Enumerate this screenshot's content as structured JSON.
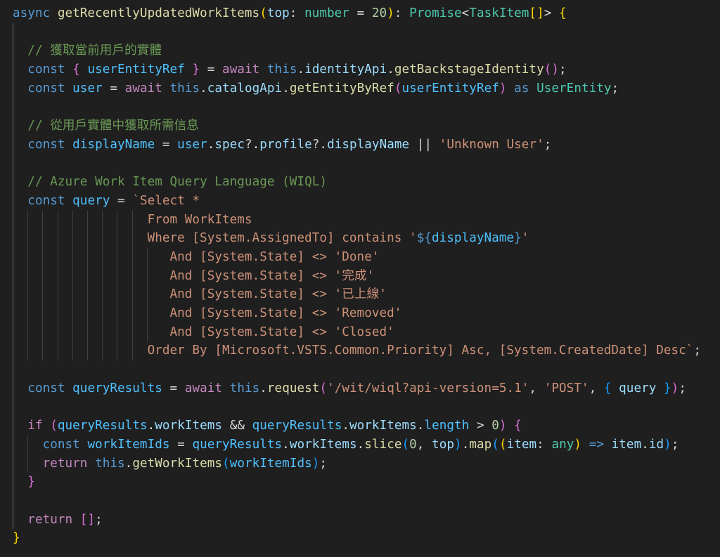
{
  "editor": {
    "theme_colors": {
      "background": "#1f1f1f",
      "keyword": "#569cd6",
      "control": "#c586c0",
      "function": "#dcdcaa",
      "variable": "#9cdcfe",
      "type": "#4ec9b0",
      "string": "#ce9178",
      "number": "#b5cea8",
      "comment": "#6a9955",
      "bracket_1": "#ffd700",
      "bracket_2": "#da70d6",
      "bracket_3": "#179fff"
    },
    "lines": [
      {
        "tokens": [
          {
            "t": "async ",
            "c": "kw"
          },
          {
            "t": "getRecentlyUpdatedWorkItems",
            "c": "fn"
          },
          {
            "t": "(",
            "c": "b1"
          },
          {
            "t": "top",
            "c": "var"
          },
          {
            "t": ": ",
            "c": "punc"
          },
          {
            "t": "number",
            "c": "type"
          },
          {
            "t": " = ",
            "c": "punc"
          },
          {
            "t": "20",
            "c": "num"
          },
          {
            "t": ")",
            "c": "b1"
          },
          {
            "t": ": ",
            "c": "punc"
          },
          {
            "t": "Promise",
            "c": "type"
          },
          {
            "t": "<",
            "c": "punc"
          },
          {
            "t": "TaskItem",
            "c": "type"
          },
          {
            "t": "[]",
            "c": "b1"
          },
          {
            "t": "> ",
            "c": "punc"
          },
          {
            "t": "{",
            "c": "b1"
          }
        ]
      },
      {
        "tokens": []
      },
      {
        "tokens": [
          {
            "t": "  ",
            "c": "punc"
          },
          {
            "t": "// 獲取當前用戶的實體",
            "c": "com"
          }
        ]
      },
      {
        "tokens": [
          {
            "t": "  ",
            "c": "punc"
          },
          {
            "t": "const ",
            "c": "kw"
          },
          {
            "t": "{ ",
            "c": "b2"
          },
          {
            "t": "userEntityRef",
            "c": "const"
          },
          {
            "t": " }",
            "c": "b2"
          },
          {
            "t": " = ",
            "c": "punc"
          },
          {
            "t": "await ",
            "c": "ctrl"
          },
          {
            "t": "this",
            "c": "kw"
          },
          {
            "t": ".",
            "c": "punc"
          },
          {
            "t": "identityApi",
            "c": "var"
          },
          {
            "t": ".",
            "c": "punc"
          },
          {
            "t": "getBackstageIdentity",
            "c": "fn"
          },
          {
            "t": "()",
            "c": "b2"
          },
          {
            "t": ";",
            "c": "punc"
          }
        ]
      },
      {
        "tokens": [
          {
            "t": "  ",
            "c": "punc"
          },
          {
            "t": "const ",
            "c": "kw"
          },
          {
            "t": "user",
            "c": "const"
          },
          {
            "t": " = ",
            "c": "punc"
          },
          {
            "t": "await ",
            "c": "ctrl"
          },
          {
            "t": "this",
            "c": "kw"
          },
          {
            "t": ".",
            "c": "punc"
          },
          {
            "t": "catalogApi",
            "c": "var"
          },
          {
            "t": ".",
            "c": "punc"
          },
          {
            "t": "getEntityByRef",
            "c": "fn"
          },
          {
            "t": "(",
            "c": "b2"
          },
          {
            "t": "userEntityRef",
            "c": "const"
          },
          {
            "t": ")",
            "c": "b2"
          },
          {
            "t": " as ",
            "c": "kw"
          },
          {
            "t": "UserEntity",
            "c": "type"
          },
          {
            "t": ";",
            "c": "punc"
          }
        ]
      },
      {
        "tokens": []
      },
      {
        "tokens": [
          {
            "t": "  ",
            "c": "punc"
          },
          {
            "t": "// 從用戶實體中獲取所需信息",
            "c": "com"
          }
        ]
      },
      {
        "tokens": [
          {
            "t": "  ",
            "c": "punc"
          },
          {
            "t": "const ",
            "c": "kw"
          },
          {
            "t": "displayName",
            "c": "const"
          },
          {
            "t": " = ",
            "c": "punc"
          },
          {
            "t": "user",
            "c": "const"
          },
          {
            "t": ".",
            "c": "punc"
          },
          {
            "t": "spec",
            "c": "var"
          },
          {
            "t": "?.",
            "c": "punc"
          },
          {
            "t": "profile",
            "c": "var"
          },
          {
            "t": "?.",
            "c": "punc"
          },
          {
            "t": "displayName",
            "c": "var"
          },
          {
            "t": " || ",
            "c": "punc"
          },
          {
            "t": "'Unknown User'",
            "c": "str"
          },
          {
            "t": ";",
            "c": "punc"
          }
        ]
      },
      {
        "tokens": []
      },
      {
        "tokens": [
          {
            "t": "  ",
            "c": "punc"
          },
          {
            "t": "// Azure Work Item Query Language (WIQL)",
            "c": "com"
          }
        ]
      },
      {
        "tokens": [
          {
            "t": "  ",
            "c": "punc"
          },
          {
            "t": "const ",
            "c": "kw"
          },
          {
            "t": "query",
            "c": "const"
          },
          {
            "t": " = ",
            "c": "punc"
          },
          {
            "t": "`Select *",
            "c": "str"
          }
        ]
      },
      {
        "tokens": [
          {
            "t": "                  ",
            "c": "punc"
          },
          {
            "t": "From WorkItems",
            "c": "str"
          }
        ]
      },
      {
        "tokens": [
          {
            "t": "                  ",
            "c": "punc"
          },
          {
            "t": "Where [System.AssignedTo] contains '",
            "c": "str"
          },
          {
            "t": "${",
            "c": "kw"
          },
          {
            "t": "displayName",
            "c": "const"
          },
          {
            "t": "}",
            "c": "kw"
          },
          {
            "t": "'",
            "c": "str"
          }
        ]
      },
      {
        "tokens": [
          {
            "t": "                     ",
            "c": "punc"
          },
          {
            "t": "And [System.State] <> 'Done'",
            "c": "str"
          }
        ]
      },
      {
        "tokens": [
          {
            "t": "                     ",
            "c": "punc"
          },
          {
            "t": "And [System.State] <> '完成'",
            "c": "str"
          }
        ]
      },
      {
        "tokens": [
          {
            "t": "                     ",
            "c": "punc"
          },
          {
            "t": "And [System.State] <> '已上線'",
            "c": "str"
          }
        ]
      },
      {
        "tokens": [
          {
            "t": "                     ",
            "c": "punc"
          },
          {
            "t": "And [System.State] <> 'Removed'",
            "c": "str"
          }
        ]
      },
      {
        "tokens": [
          {
            "t": "                     ",
            "c": "punc"
          },
          {
            "t": "And [System.State] <> 'Closed'",
            "c": "str"
          }
        ]
      },
      {
        "tokens": [
          {
            "t": "                  ",
            "c": "punc"
          },
          {
            "t": "Order By [Microsoft.VSTS.Common.Priority] Asc, [System.CreatedDate] Desc`",
            "c": "str"
          },
          {
            "t": ";",
            "c": "punc"
          }
        ]
      },
      {
        "tokens": []
      },
      {
        "tokens": [
          {
            "t": "  ",
            "c": "punc"
          },
          {
            "t": "const ",
            "c": "kw"
          },
          {
            "t": "queryResults",
            "c": "const"
          },
          {
            "t": " = ",
            "c": "punc"
          },
          {
            "t": "await ",
            "c": "ctrl"
          },
          {
            "t": "this",
            "c": "kw"
          },
          {
            "t": ".",
            "c": "punc"
          },
          {
            "t": "request",
            "c": "fn"
          },
          {
            "t": "(",
            "c": "b2"
          },
          {
            "t": "'/wit/wiql?api-version=5.1'",
            "c": "str"
          },
          {
            "t": ", ",
            "c": "punc"
          },
          {
            "t": "'POST'",
            "c": "str"
          },
          {
            "t": ", ",
            "c": "punc"
          },
          {
            "t": "{ ",
            "c": "b3"
          },
          {
            "t": "query",
            "c": "var"
          },
          {
            "t": " }",
            "c": "b3"
          },
          {
            "t": ")",
            "c": "b2"
          },
          {
            "t": ";",
            "c": "punc"
          }
        ]
      },
      {
        "tokens": []
      },
      {
        "tokens": [
          {
            "t": "  ",
            "c": "punc"
          },
          {
            "t": "if ",
            "c": "ctrl"
          },
          {
            "t": "(",
            "c": "b2"
          },
          {
            "t": "queryResults",
            "c": "const"
          },
          {
            "t": ".",
            "c": "punc"
          },
          {
            "t": "workItems",
            "c": "var"
          },
          {
            "t": " && ",
            "c": "punc"
          },
          {
            "t": "queryResults",
            "c": "const"
          },
          {
            "t": ".",
            "c": "punc"
          },
          {
            "t": "workItems",
            "c": "var"
          },
          {
            "t": ".",
            "c": "punc"
          },
          {
            "t": "length",
            "c": "const"
          },
          {
            "t": " > ",
            "c": "punc"
          },
          {
            "t": "0",
            "c": "num"
          },
          {
            "t": ")",
            "c": "b2"
          },
          {
            "t": " ",
            "c": "punc"
          },
          {
            "t": "{",
            "c": "b2"
          }
        ]
      },
      {
        "tokens": [
          {
            "t": "    ",
            "c": "punc"
          },
          {
            "t": "const ",
            "c": "kw"
          },
          {
            "t": "workItemIds",
            "c": "const"
          },
          {
            "t": " = ",
            "c": "punc"
          },
          {
            "t": "queryResults",
            "c": "const"
          },
          {
            "t": ".",
            "c": "punc"
          },
          {
            "t": "workItems",
            "c": "var"
          },
          {
            "t": ".",
            "c": "punc"
          },
          {
            "t": "slice",
            "c": "fn"
          },
          {
            "t": "(",
            "c": "b3"
          },
          {
            "t": "0",
            "c": "num"
          },
          {
            "t": ", ",
            "c": "punc"
          },
          {
            "t": "top",
            "c": "var"
          },
          {
            "t": ")",
            "c": "b3"
          },
          {
            "t": ".",
            "c": "punc"
          },
          {
            "t": "map",
            "c": "fn"
          },
          {
            "t": "(",
            "c": "b3"
          },
          {
            "t": "(",
            "c": "b1"
          },
          {
            "t": "item",
            "c": "var"
          },
          {
            "t": ": ",
            "c": "punc"
          },
          {
            "t": "any",
            "c": "type"
          },
          {
            "t": ")",
            "c": "b1"
          },
          {
            "t": " => ",
            "c": "kw"
          },
          {
            "t": "item",
            "c": "var"
          },
          {
            "t": ".",
            "c": "punc"
          },
          {
            "t": "id",
            "c": "var"
          },
          {
            "t": ")",
            "c": "b3"
          },
          {
            "t": ";",
            "c": "punc"
          }
        ]
      },
      {
        "tokens": [
          {
            "t": "    ",
            "c": "punc"
          },
          {
            "t": "return ",
            "c": "ctrl"
          },
          {
            "t": "this",
            "c": "kw"
          },
          {
            "t": ".",
            "c": "punc"
          },
          {
            "t": "getWorkItems",
            "c": "fn"
          },
          {
            "t": "(",
            "c": "b3"
          },
          {
            "t": "workItemIds",
            "c": "const"
          },
          {
            "t": ")",
            "c": "b3"
          },
          {
            "t": ";",
            "c": "punc"
          }
        ]
      },
      {
        "tokens": [
          {
            "t": "  ",
            "c": "punc"
          },
          {
            "t": "}",
            "c": "b2"
          }
        ]
      },
      {
        "tokens": []
      },
      {
        "tokens": [
          {
            "t": "  ",
            "c": "punc"
          },
          {
            "t": "return ",
            "c": "ctrl"
          },
          {
            "t": "[]",
            "c": "b2"
          },
          {
            "t": ";",
            "c": "punc"
          }
        ]
      },
      {
        "tokens": [
          {
            "t": "}",
            "c": "b1"
          }
        ]
      }
    ]
  }
}
